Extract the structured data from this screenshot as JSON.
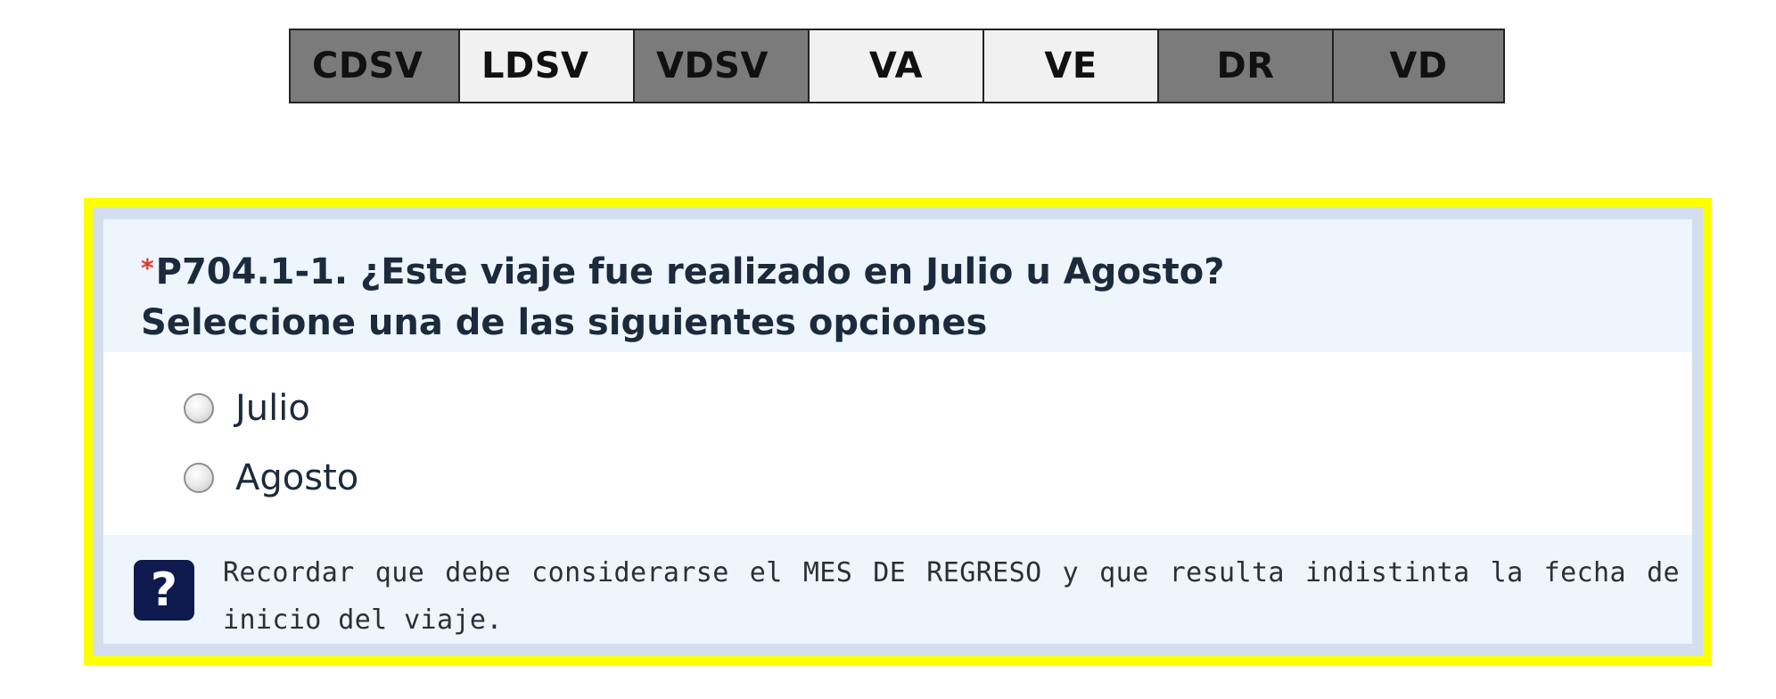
{
  "tabs": [
    {
      "label": "CDSV",
      "style": "dark"
    },
    {
      "label": "LDSV",
      "style": "light"
    },
    {
      "label": "VDSV",
      "style": "dark"
    },
    {
      "label": "VA",
      "style": "light"
    },
    {
      "label": "VE",
      "style": "light"
    },
    {
      "label": "DR",
      "style": "dark"
    },
    {
      "label": "VD",
      "style": "dark"
    }
  ],
  "question": {
    "required_mark": "*",
    "title": "P704.1-1. ¿Este viaje fue realizado en Julio u Agosto?",
    "instruction": "Seleccione una de las siguientes opciones",
    "options": [
      {
        "label": "Julio",
        "selected": false
      },
      {
        "label": "Agosto",
        "selected": false
      }
    ]
  },
  "help": {
    "icon": "question-mark-icon",
    "icon_glyph": "?",
    "text": "Recordar que debe considerarse el MES DE REGRESO y que resulta indistinta la fecha de inicio del viaje."
  },
  "colors": {
    "highlight_border": "#ffff00",
    "frame": "#d3dfee",
    "header_bg": "#eef5fd",
    "required": "#e03a2e",
    "tab_dark": "#7b7b7b",
    "tab_light": "#f1f1f1",
    "help_icon_bg": "#0f1a4f"
  }
}
